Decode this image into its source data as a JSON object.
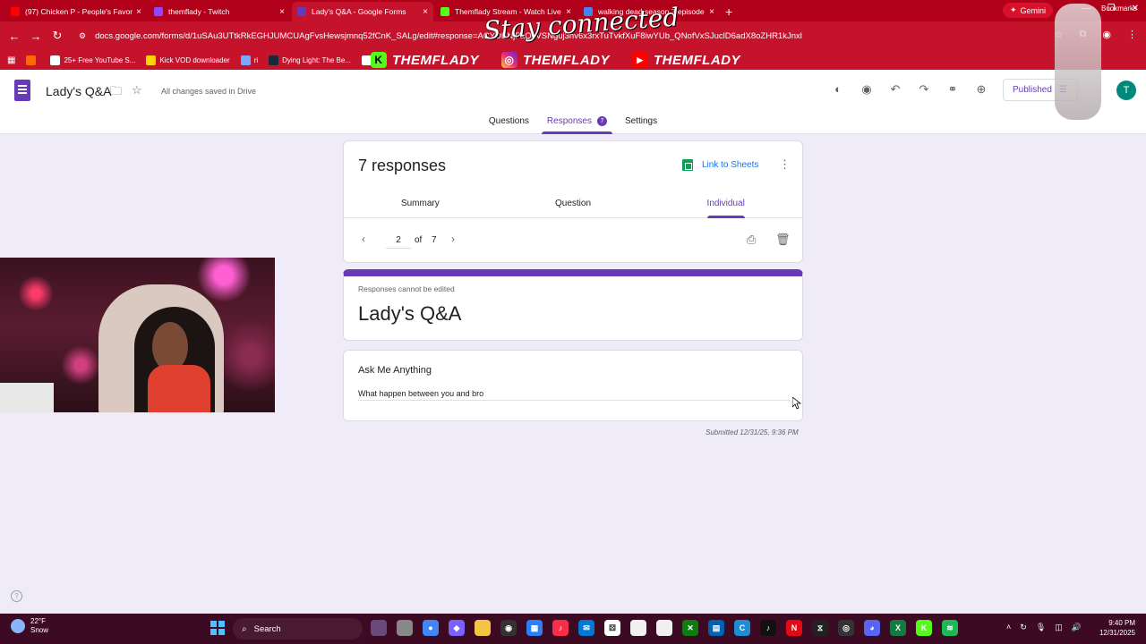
{
  "browser": {
    "tabs": [
      {
        "label": "(97) Chicken P - People's Favor",
        "icon": "youtube-icon",
        "color": "#ff0000",
        "active": false
      },
      {
        "label": "themflady - Twitch",
        "icon": "twitch-icon",
        "color": "#9146ff",
        "active": false
      },
      {
        "label": "Lady's Q&A - Google Forms",
        "icon": "forms-icon",
        "color": "#673ab7",
        "active": true
      },
      {
        "label": "Themflady Stream - Watch Live",
        "icon": "kick-icon",
        "color": "#53fc18",
        "active": false
      },
      {
        "label": "walking dead season 7 episode",
        "icon": "google-icon",
        "color": "#4285f4",
        "active": false
      }
    ],
    "gemini_label": "Gemini",
    "url": "docs.google.com/forms/d/1uSAu3UTtkRkEGHJUMCUAgFvsHewsjmnq52fCnK_SALg/edit#response=ACYDBNjFaQzVSNguj3hv6x3rxTuTvkfXuF8iwYUb_QNofVxSJuclD6adX8oZHR1kJnxl",
    "bookmarks": [
      {
        "label": "",
        "icon": "podcast-icon",
        "color": "#ff6a00"
      },
      {
        "label": "25+ Free YouTube S...",
        "icon": "p-icon",
        "color": "#ffffff"
      },
      {
        "label": "Kick VOD downloader",
        "icon": "d-icon",
        "color": "#ffd400"
      },
      {
        "label": "ri",
        "icon": "sl-icon",
        "color": "#7aa7ff"
      },
      {
        "label": "Dying Light: The Be...",
        "icon": "steam-icon",
        "color": "#1b2838"
      },
      {
        "label": "En",
        "icon": "trash-icon",
        "color": "#ffffff"
      }
    ],
    "bookmarks_end": "Bookmarks"
  },
  "overlay": {
    "brands": [
      {
        "label": "THEMFLADY",
        "icon": "kick-logo-icon",
        "glyph": "K"
      },
      {
        "label": "THEMFLADY",
        "icon": "instagram-logo-icon",
        "glyph": "◎"
      },
      {
        "label": "THEMFLADY",
        "icon": "youtube-logo-icon",
        "glyph": "▶"
      }
    ],
    "tagline": "Stay connected"
  },
  "forms_header": {
    "title": "Lady's Q&A",
    "saved_status": "All changes saved in Drive",
    "publish_label": "Published",
    "avatar_letter": "T",
    "tabs": [
      {
        "label": "Questions",
        "active": false
      },
      {
        "label": "Responses",
        "active": true,
        "badge": "7"
      },
      {
        "label": "Settings",
        "active": false
      }
    ]
  },
  "responses": {
    "count_label": "7 responses",
    "link_to_sheets": "Link to Sheets",
    "subtabs": [
      {
        "label": "Summary",
        "active": false
      },
      {
        "label": "Question",
        "active": false
      },
      {
        "label": "Individual",
        "active": true
      }
    ],
    "pager": {
      "current": "2",
      "of_label": "of",
      "total": "7"
    }
  },
  "response_view": {
    "notice": "Responses cannot be edited",
    "form_title": "Lady's Q&A",
    "question": "Ask Me Anything",
    "answer": "What happen between you and bro",
    "submitted": "Submitted 12/31/25, 9:36 PM"
  },
  "taskbar": {
    "weather_temp": "22°F",
    "weather_desc": "Snow",
    "search_label": "Search",
    "apps": [
      {
        "icon": "paint-icon",
        "color": "#6a4a7a",
        "glyph": ""
      },
      {
        "icon": "tablet-icon",
        "color": "#888888",
        "glyph": ""
      },
      {
        "icon": "chrome-icon",
        "color": "#4285f4",
        "glyph": "●"
      },
      {
        "icon": "copilot-icon",
        "color": "#7b61ff",
        "glyph": "◆"
      },
      {
        "icon": "folder-icon",
        "color": "#f4c542",
        "glyph": ""
      },
      {
        "icon": "obs-icon",
        "color": "#333333",
        "glyph": "◉"
      },
      {
        "icon": "calendar-icon",
        "color": "#2d7ff9",
        "glyph": "▦"
      },
      {
        "icon": "music-icon",
        "color": "#fa2d48",
        "glyph": "♪"
      },
      {
        "icon": "mail-icon",
        "color": "#0078d4",
        "glyph": "✉"
      },
      {
        "icon": "dice-icon",
        "color": "#ffffff",
        "glyph": "⚄"
      },
      {
        "icon": "file-icon",
        "color": "#f0f0f0",
        "glyph": ""
      },
      {
        "icon": "document-icon",
        "color": "#f0f0f0",
        "glyph": ""
      },
      {
        "icon": "xbox-icon",
        "color": "#107c10",
        "glyph": "✕"
      },
      {
        "icon": "store-icon",
        "color": "#0063b1",
        "glyph": "▤"
      },
      {
        "icon": "ccleaner-icon",
        "color": "#1f8dd6",
        "glyph": "C"
      },
      {
        "icon": "tiktok-icon",
        "color": "#111111",
        "glyph": "♪"
      },
      {
        "icon": "netflix-icon",
        "color": "#e50914",
        "glyph": "N"
      },
      {
        "icon": "capcut-icon",
        "color": "#222222",
        "glyph": "⧖"
      },
      {
        "icon": "nvidia-icon",
        "color": "#333333",
        "glyph": "◎"
      },
      {
        "icon": "discord-icon",
        "color": "#5865f2",
        "glyph": "◕"
      },
      {
        "icon": "excel-icon",
        "color": "#107c41",
        "glyph": "X"
      },
      {
        "icon": "kick-app-icon",
        "color": "#53fc18",
        "glyph": "K"
      },
      {
        "icon": "spotify-icon",
        "color": "#1db954",
        "glyph": "≋"
      }
    ],
    "time": "9:40 PM",
    "date": "12/31/2025"
  }
}
